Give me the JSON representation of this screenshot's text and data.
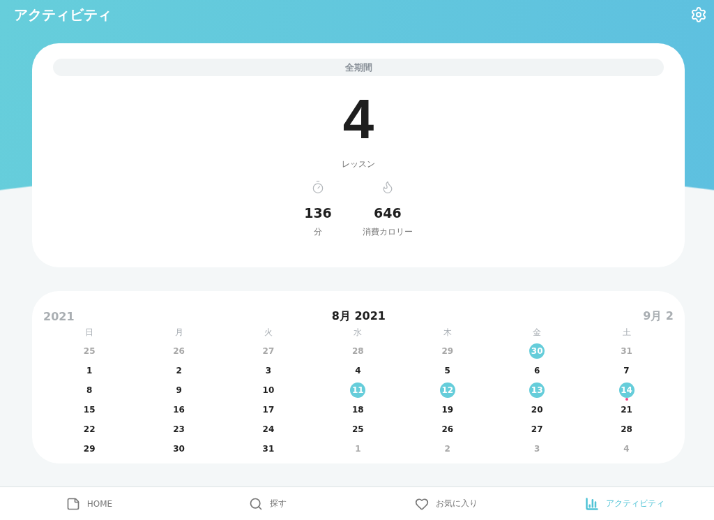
{
  "header": {
    "title": "アクティビティ"
  },
  "summary": {
    "period": "全期間",
    "count": "4",
    "count_label": "レッスン",
    "stats": [
      {
        "kind": "time",
        "value": "136",
        "label": "分"
      },
      {
        "kind": "calories",
        "value": "646",
        "label": "消費カロリー"
      }
    ]
  },
  "calendar": {
    "prev_month": "2021",
    "title": "8月 2021",
    "next_month": "9月 2",
    "weekdays": [
      "日",
      "月",
      "火",
      "水",
      "木",
      "金",
      "土"
    ],
    "days": [
      {
        "label": "25",
        "outside": true,
        "active": false,
        "marked": false
      },
      {
        "label": "26",
        "outside": true,
        "active": false,
        "marked": false
      },
      {
        "label": "27",
        "outside": true,
        "active": false,
        "marked": false
      },
      {
        "label": "28",
        "outside": true,
        "active": false,
        "marked": false
      },
      {
        "label": "29",
        "outside": true,
        "active": false,
        "marked": false
      },
      {
        "label": "30",
        "outside": true,
        "active": true,
        "marked": false
      },
      {
        "label": "31",
        "outside": true,
        "active": false,
        "marked": false
      },
      {
        "label": "1",
        "outside": false,
        "active": false,
        "marked": false
      },
      {
        "label": "2",
        "outside": false,
        "active": false,
        "marked": false
      },
      {
        "label": "3",
        "outside": false,
        "active": false,
        "marked": false
      },
      {
        "label": "4",
        "outside": false,
        "active": false,
        "marked": false
      },
      {
        "label": "5",
        "outside": false,
        "active": false,
        "marked": false
      },
      {
        "label": "6",
        "outside": false,
        "active": false,
        "marked": false
      },
      {
        "label": "7",
        "outside": false,
        "active": false,
        "marked": false
      },
      {
        "label": "8",
        "outside": false,
        "active": false,
        "marked": false
      },
      {
        "label": "9",
        "outside": false,
        "active": false,
        "marked": false
      },
      {
        "label": "10",
        "outside": false,
        "active": false,
        "marked": false
      },
      {
        "label": "11",
        "outside": false,
        "active": true,
        "marked": false
      },
      {
        "label": "12",
        "outside": false,
        "active": true,
        "marked": false
      },
      {
        "label": "13",
        "outside": false,
        "active": true,
        "marked": false
      },
      {
        "label": "14",
        "outside": false,
        "active": true,
        "marked": true
      },
      {
        "label": "15",
        "outside": false,
        "active": false,
        "marked": false
      },
      {
        "label": "16",
        "outside": false,
        "active": false,
        "marked": false
      },
      {
        "label": "17",
        "outside": false,
        "active": false,
        "marked": false
      },
      {
        "label": "18",
        "outside": false,
        "active": false,
        "marked": false
      },
      {
        "label": "19",
        "outside": false,
        "active": false,
        "marked": false
      },
      {
        "label": "20",
        "outside": false,
        "active": false,
        "marked": false
      },
      {
        "label": "21",
        "outside": false,
        "active": false,
        "marked": false
      },
      {
        "label": "22",
        "outside": false,
        "active": false,
        "marked": false
      },
      {
        "label": "23",
        "outside": false,
        "active": false,
        "marked": false
      },
      {
        "label": "24",
        "outside": false,
        "active": false,
        "marked": false
      },
      {
        "label": "25",
        "outside": false,
        "active": false,
        "marked": false
      },
      {
        "label": "26",
        "outside": false,
        "active": false,
        "marked": false
      },
      {
        "label": "27",
        "outside": false,
        "active": false,
        "marked": false
      },
      {
        "label": "28",
        "outside": false,
        "active": false,
        "marked": false
      },
      {
        "label": "29",
        "outside": false,
        "active": false,
        "marked": false
      },
      {
        "label": "30",
        "outside": false,
        "active": false,
        "marked": false
      },
      {
        "label": "31",
        "outside": false,
        "active": false,
        "marked": false
      },
      {
        "label": "1",
        "outside": true,
        "active": false,
        "marked": false
      },
      {
        "label": "2",
        "outside": true,
        "active": false,
        "marked": false
      },
      {
        "label": "3",
        "outside": true,
        "active": false,
        "marked": false
      },
      {
        "label": "4",
        "outside": true,
        "active": false,
        "marked": false
      }
    ]
  },
  "tab_bar": [
    {
      "kind": "home",
      "label": "HOME",
      "selected": false
    },
    {
      "kind": "search",
      "label": "探す",
      "selected": false
    },
    {
      "kind": "favorites",
      "label": "お気に入り",
      "selected": false
    },
    {
      "kind": "activity",
      "label": "アクティビティ",
      "selected": true
    }
  ]
}
